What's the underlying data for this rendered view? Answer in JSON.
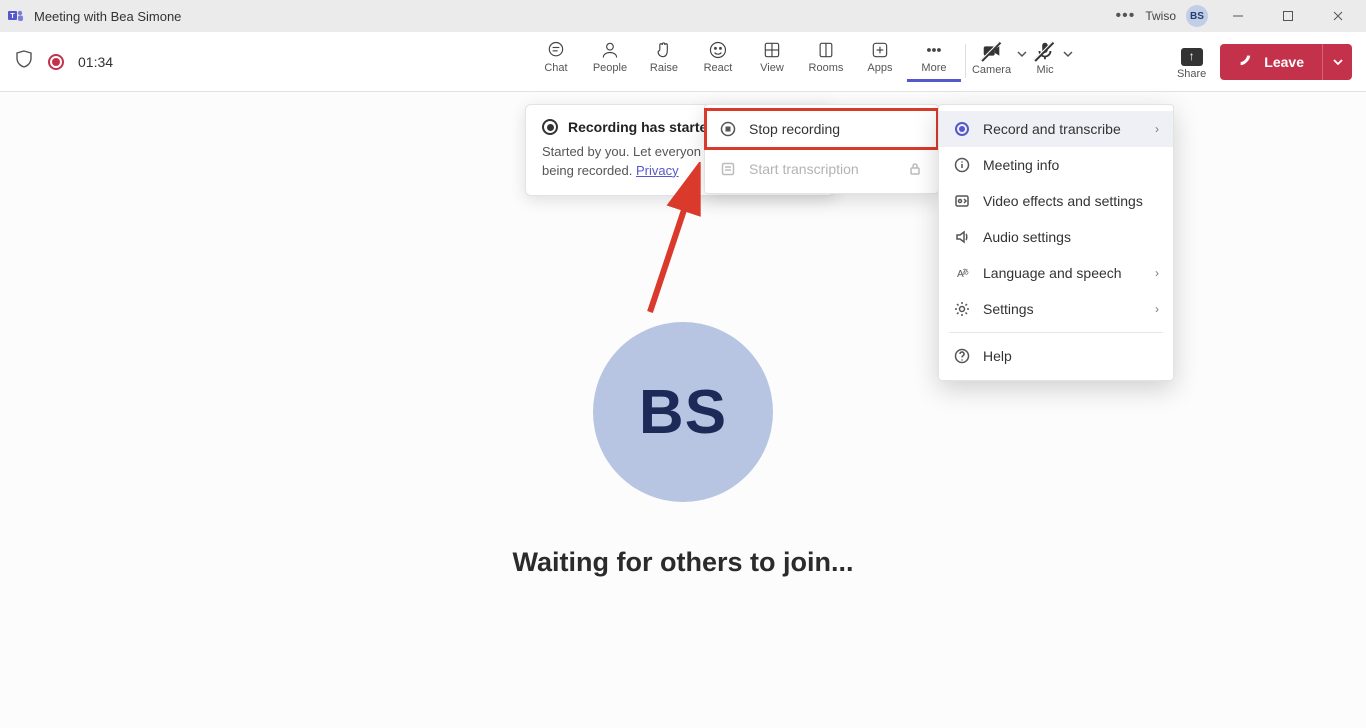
{
  "titlebar": {
    "title": "Meeting with Bea Simone",
    "user": "Twiso",
    "avatar": "BS"
  },
  "toolbar": {
    "timer": "01:34",
    "items": {
      "chat": "Chat",
      "people": "People",
      "raise": "Raise",
      "react": "React",
      "view": "View",
      "rooms": "Rooms",
      "apps": "Apps",
      "more": "More",
      "camera": "Camera",
      "mic": "Mic",
      "share": "Share",
      "leave": "Leave"
    }
  },
  "rec_popup": {
    "title": "Recording has started",
    "body_prefix": "Started by you. Let everyon",
    "body_line2": "being recorded. ",
    "link": "Privacy"
  },
  "submenu": {
    "stop": "Stop recording",
    "start_trans": "Start transcription"
  },
  "more_menu": {
    "record": "Record and transcribe",
    "info": "Meeting info",
    "video": "Video effects and settings",
    "audio": "Audio settings",
    "lang": "Language and speech",
    "settings": "Settings",
    "help": "Help"
  },
  "main": {
    "avatar": "BS",
    "waiting": "Waiting for others to join..."
  }
}
